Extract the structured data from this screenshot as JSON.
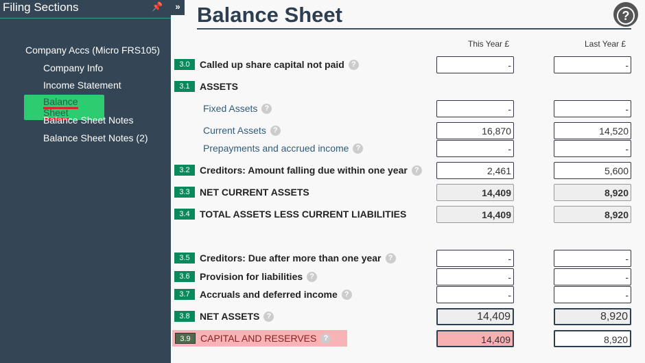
{
  "sidebar": {
    "title": "Filing Sections",
    "pin_icon": "pin-icon",
    "expand_icon": "double-chevron-right-icon",
    "items": [
      {
        "label": "Company Accs (Micro FRS105)"
      },
      {
        "label": "Company Info"
      },
      {
        "label": "Income Statement"
      },
      {
        "label": "Balance Sheet",
        "active": true
      },
      {
        "label": "Balance Sheet Notes"
      },
      {
        "label": "Balance Sheet Notes (2)"
      }
    ]
  },
  "header": {
    "title": "Balance Sheet",
    "help_label": "?"
  },
  "columns": {
    "this_year": "This Year £",
    "last_year": "Last Year £"
  },
  "rows": [
    {
      "num": "3.0",
      "label": "Called up share capital not paid",
      "this": "-",
      "last": "-"
    },
    {
      "num": "3.1",
      "label": "ASSETS"
    },
    {
      "label": "Fixed Assets",
      "this": "-",
      "last": "-"
    },
    {
      "label": "Current Assets",
      "this": "16,870",
      "last": "14,520"
    },
    {
      "label": "Prepayments and accrued income",
      "this": "-",
      "last": "-"
    },
    {
      "num": "3.2",
      "label": "Creditors: Amount falling due within one year",
      "this": "2,461",
      "last": "5,600"
    },
    {
      "num": "3.3",
      "label": "NET CURRENT ASSETS",
      "this": "14,409",
      "last": "8,920"
    },
    {
      "num": "3.4",
      "label": "TOTAL ASSETS LESS CURRENT LIABILITIES",
      "this": "14,409",
      "last": "8,920"
    },
    {
      "num": "3.5",
      "label": "Creditors: Due after more than one year",
      "this": "-",
      "last": "-"
    },
    {
      "num": "3.6",
      "label": "Provision for liabilities",
      "this": "-",
      "last": "-"
    },
    {
      "num": "3.7",
      "label": "Accruals and deferred income",
      "this": "-",
      "last": "-"
    },
    {
      "num": "3.8",
      "label": "NET ASSETS",
      "this": "14,409",
      "last": "8,920"
    },
    {
      "num": "3.9",
      "label": "CAPITAL AND RESERVES",
      "this": "14,409",
      "last": "8,920"
    }
  ],
  "colors": {
    "sidebar": "#344556",
    "badge": "#0a8a5c",
    "active": "#2ecc71",
    "error": "#f7b3b5"
  }
}
